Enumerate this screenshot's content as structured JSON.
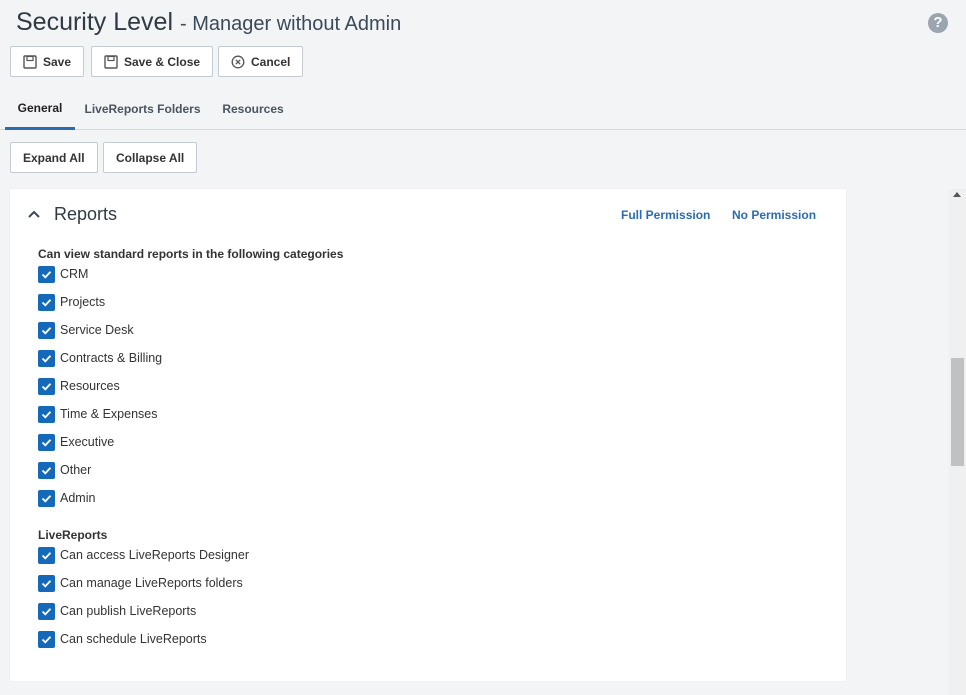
{
  "header": {
    "title": "Security Level",
    "subtitle": "- Manager without Admin",
    "help_glyph": "?"
  },
  "toolbar": {
    "save_label": "Save",
    "save_close_label": "Save & Close",
    "cancel_label": "Cancel"
  },
  "tabs": [
    {
      "label": "General",
      "active": true
    },
    {
      "label": "LiveReports Folders",
      "active": false
    },
    {
      "label": "Resources",
      "active": false
    }
  ],
  "expand_all_label": "Expand All",
  "collapse_all_label": "Collapse All",
  "section": {
    "title": "Reports",
    "full_permission": "Full Permission",
    "no_permission": "No Permission",
    "group1_label": "Can view standard reports in the following categories",
    "group1_items": [
      {
        "label": "CRM",
        "checked": true
      },
      {
        "label": "Projects",
        "checked": true
      },
      {
        "label": "Service Desk",
        "checked": true
      },
      {
        "label": "Contracts & Billing",
        "checked": true
      },
      {
        "label": "Resources",
        "checked": true
      },
      {
        "label": "Time & Expenses",
        "checked": true
      },
      {
        "label": "Executive",
        "checked": true
      },
      {
        "label": "Other",
        "checked": true
      },
      {
        "label": "Admin",
        "checked": true
      }
    ],
    "group2_label": "LiveReports",
    "group2_items": [
      {
        "label": "Can access LiveReports Designer",
        "checked": true
      },
      {
        "label": "Can manage LiveReports folders",
        "checked": true
      },
      {
        "label": "Can publish LiveReports",
        "checked": true
      },
      {
        "label": "Can schedule LiveReports",
        "checked": true
      }
    ]
  },
  "colors": {
    "accent": "#2b6cb0",
    "checkbox": "#1469b8",
    "background": "#f3f4f6"
  }
}
